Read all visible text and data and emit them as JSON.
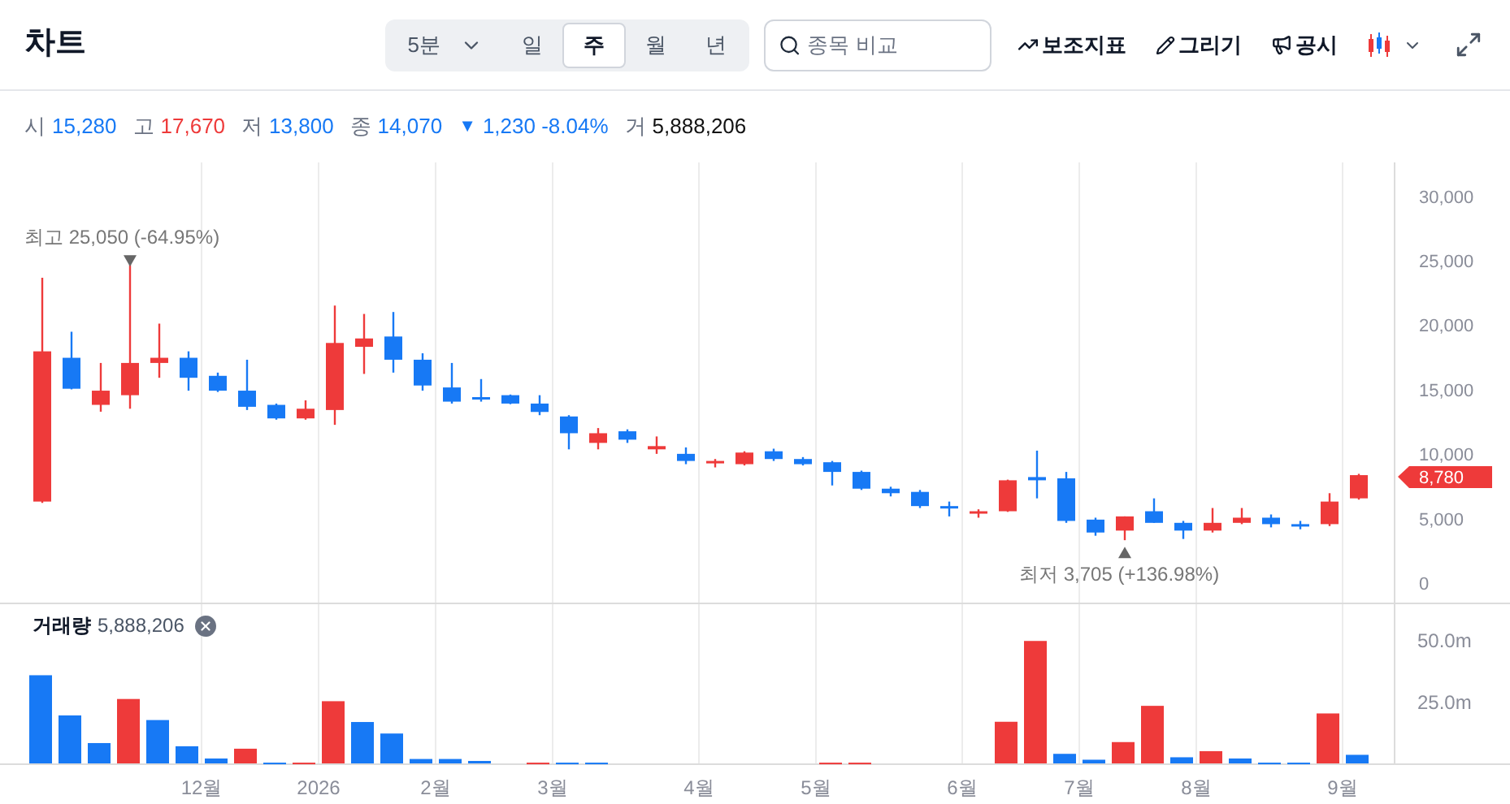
{
  "header": {
    "title": "차트"
  },
  "periods": [
    {
      "label": "5분",
      "kind": "dropdown",
      "selected": false
    },
    {
      "label": "일",
      "kind": "tab",
      "selected": false
    },
    {
      "label": "주",
      "kind": "tab",
      "selected": true
    },
    {
      "label": "월",
      "kind": "tab",
      "selected": false
    },
    {
      "label": "년",
      "kind": "tab",
      "selected": false
    }
  ],
  "search": {
    "placeholder": "종목 비교"
  },
  "tools": [
    {
      "label": "보조지표",
      "kind": "indicator"
    },
    {
      "label": "그리기",
      "kind": "draw"
    },
    {
      "label": "공시",
      "kind": "notice"
    }
  ],
  "quote": [
    {
      "kind": "price",
      "label": "시",
      "value": "15,280",
      "color": "#1779f5"
    },
    {
      "kind": "price",
      "label": "고",
      "value": "17,670",
      "color": "#ee3a3a"
    },
    {
      "kind": "price",
      "label": "저",
      "value": "13,800",
      "color": "#1779f5"
    },
    {
      "kind": "price",
      "label": "종",
      "value": "14,070",
      "color": "#1779f5"
    },
    {
      "kind": "change",
      "label": "▼",
      "value": "1,230 -8.04%",
      "color": "#1779f5"
    },
    {
      "kind": "price",
      "label": "거",
      "value": "5,888,206",
      "color": "#111111"
    }
  ],
  "price_chart": {
    "chart_data": {
      "type": "candlestick",
      "ylim": [
        -1260,
        33000
      ],
      "categories": [
        null,
        null,
        null,
        null,
        null,
        null,
        null,
        null,
        null,
        null,
        null,
        null,
        null,
        null,
        null,
        null,
        null,
        null,
        null,
        null,
        null,
        null,
        null,
        null,
        null,
        null,
        null,
        null,
        null,
        null,
        null,
        null,
        null,
        null,
        null,
        null,
        null,
        null,
        null,
        null,
        null,
        null,
        null,
        null,
        null,
        null
      ],
      "yticks": [
        {
          "value": 0,
          "label": "0"
        },
        {
          "value": 5000,
          "label": "5,000"
        },
        {
          "value": 10000,
          "label": "10,000"
        },
        {
          "value": 15000,
          "label": "15,000"
        },
        {
          "value": 20000,
          "label": "20,000"
        },
        {
          "value": 25000,
          "label": "25,000"
        },
        {
          "value": 30000,
          "label": "30,000"
        }
      ],
      "ohlc": [
        [
          6700,
          24050,
          6600,
          18350
        ],
        [
          17850,
          19870,
          15400,
          15450
        ],
        [
          14200,
          17450,
          13670,
          15300
        ],
        [
          14950,
          25050,
          13900,
          17450
        ],
        [
          17450,
          20500,
          16300,
          17850
        ],
        [
          17850,
          18350,
          15300,
          16300
        ],
        [
          16450,
          16700,
          15200,
          15300
        ],
        [
          15300,
          17700,
          13800,
          14050
        ],
        [
          14200,
          14300,
          13050,
          13150
        ],
        [
          13150,
          14550,
          13050,
          13900
        ],
        [
          13800,
          21900,
          12650,
          19000
        ],
        [
          18700,
          21250,
          16600,
          19350
        ],
        [
          19500,
          21400,
          16700,
          17700
        ],
        [
          17700,
          18200,
          15300,
          15700
        ],
        [
          15550,
          17450,
          14300,
          14450
        ],
        [
          14800,
          16200,
          14450,
          14700
        ],
        [
          14950,
          15000,
          14250,
          14300
        ],
        [
          14300,
          14950,
          13400,
          13650
        ],
        [
          13300,
          13400,
          10750,
          12000
        ],
        [
          11250,
          12400,
          10750,
          12000
        ],
        [
          12150,
          12300,
          11250,
          11500
        ],
        [
          10750,
          11750,
          10400,
          11000
        ],
        [
          10400,
          10900,
          9600,
          9850
        ],
        [
          9750,
          10000,
          9350,
          9850
        ],
        [
          9600,
          10600,
          9500,
          10500
        ],
        [
          10600,
          10800,
          9850,
          10000
        ],
        [
          10000,
          10150,
          9500,
          9600
        ],
        [
          9750,
          9850,
          7950,
          9000
        ],
        [
          9000,
          9100,
          7600,
          7700
        ],
        [
          7700,
          7850,
          7100,
          7350
        ],
        [
          7450,
          7600,
          6200,
          6350
        ],
        [
          6350,
          6700,
          5550,
          6200
        ],
        [
          5800,
          6100,
          5450,
          5950
        ],
        [
          5950,
          8400,
          5900,
          8350
        ],
        [
          8600,
          10650,
          6950,
          8350
        ],
        [
          8500,
          9000,
          5050,
          5200
        ],
        [
          5300,
          5450,
          4050,
          4300
        ],
        [
          4450,
          5550,
          3705,
          5550
        ],
        [
          5950,
          6950,
          5050,
          5050
        ],
        [
          5050,
          5200,
          3800,
          4450
        ],
        [
          4450,
          6200,
          4300,
          5050
        ],
        [
          5050,
          6200,
          4950,
          5450
        ],
        [
          5450,
          5700,
          4700,
          4950
        ],
        [
          4950,
          5200,
          4550,
          4800
        ],
        [
          4950,
          7350,
          4800,
          6700
        ],
        [
          6950,
          8850,
          6850,
          8750
        ]
      ],
      "annotations": [
        "최고 25,050 (-64.95%)",
        "최저 3,705 (+136.98%)",
        "8,780"
      ],
      "grid": true
    }
  },
  "volume_chart": {
    "label": "거래량",
    "value": "5,888,206",
    "chart_data": {
      "type": "bar",
      "ylim": [
        0,
        65
      ],
      "grid": true,
      "categories": [
        null,
        null,
        null,
        null,
        null,
        "12월",
        null,
        null,
        null,
        "2026",
        null,
        null,
        null,
        "2월",
        null,
        null,
        null,
        "3월",
        null,
        null,
        null,
        null,
        "4월",
        null,
        null,
        null,
        "5월",
        null,
        null,
        null,
        null,
        "6월",
        null,
        null,
        null,
        "7월",
        null,
        null,
        null,
        "8월",
        null,
        null,
        null,
        null,
        "9월",
        null
      ],
      "yticks": [
        {
          "value": 25,
          "label": "25.0m"
        },
        {
          "value": 50,
          "label": "50.0m"
        }
      ],
      "series": [
        {
          "color": "#ee3a3a",
          "values": [
            null,
            null,
            null,
            26.3,
            null,
            null,
            null,
            6,
            null,
            0.3,
            25.4,
            null,
            null,
            null,
            null,
            null,
            null,
            0.3,
            null,
            null,
            null,
            null,
            null,
            null,
            null,
            null,
            null,
            0.3,
            0.3,
            null,
            null,
            null,
            null,
            17,
            50,
            null,
            null,
            8.7,
            23.5,
            null,
            5,
            null,
            null,
            null,
            20.4,
            null
          ]
        },
        {
          "color": "#1779f5",
          "values": [
            36,
            19.6,
            8.3,
            null,
            17.7,
            7,
            2,
            null,
            0.3,
            null,
            null,
            16.9,
            12.2,
            1.8,
            1.8,
            1,
            null,
            null,
            0.3,
            0.3,
            null,
            null,
            null,
            null,
            null,
            null,
            null,
            null,
            null,
            null,
            null,
            null,
            null,
            null,
            null,
            3.9,
            1.5,
            null,
            null,
            2.5,
            null,
            2,
            0.3,
            0.3,
            null,
            3.5
          ]
        }
      ]
    }
  }
}
